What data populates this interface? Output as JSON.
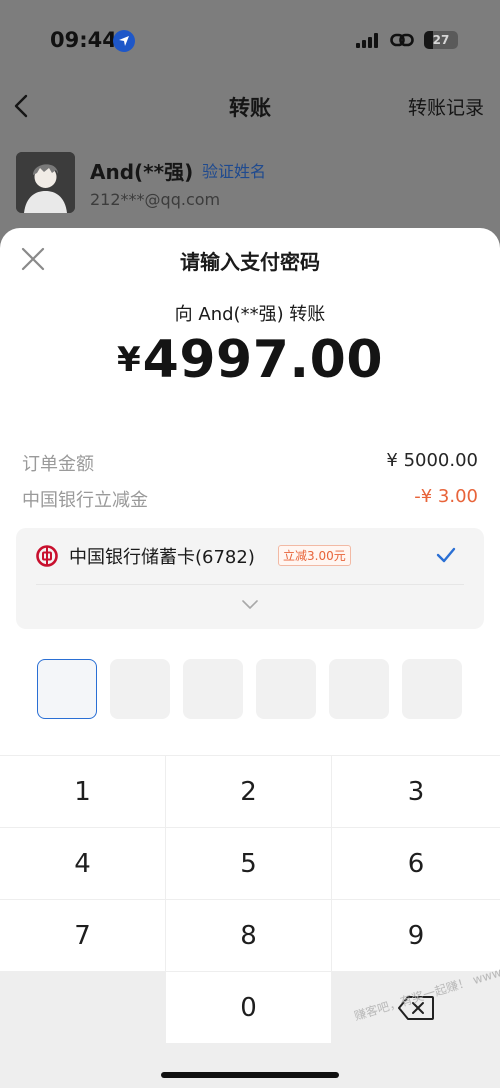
{
  "status_bar": {
    "time": "09:44",
    "battery": "27",
    "battery_level": 0.27
  },
  "nav": {
    "title": "转账",
    "right_label": "转账记录"
  },
  "payee": {
    "name": "And(**强)",
    "verify_label": "验证姓名",
    "account": "212***@qq.com"
  },
  "sheet": {
    "title": "请输入支付密码",
    "transfer_to": "向 And(**强) 转账",
    "currency": "¥",
    "amount": "4997.00",
    "order_label": "订单金额",
    "order_value": "¥ 5000.00",
    "discount_label": "中国银行立减金",
    "discount_value": "-¥ 3.00",
    "card": {
      "name": "中国银行储蓄卡(6782)",
      "tag": "立减3.00元"
    }
  },
  "keypad": {
    "keys": [
      "1",
      "2",
      "3",
      "4",
      "5",
      "6",
      "7",
      "8",
      "9",
      "",
      "0",
      "delete"
    ]
  },
  "watermark": "赚客吧，有奖一起赚！ www.zuanke8.com",
  "colors": {
    "accent": "#2a6fd4",
    "discount": "#e8643a",
    "link": "#1f4a8f",
    "bank_red": "#c8102e"
  }
}
